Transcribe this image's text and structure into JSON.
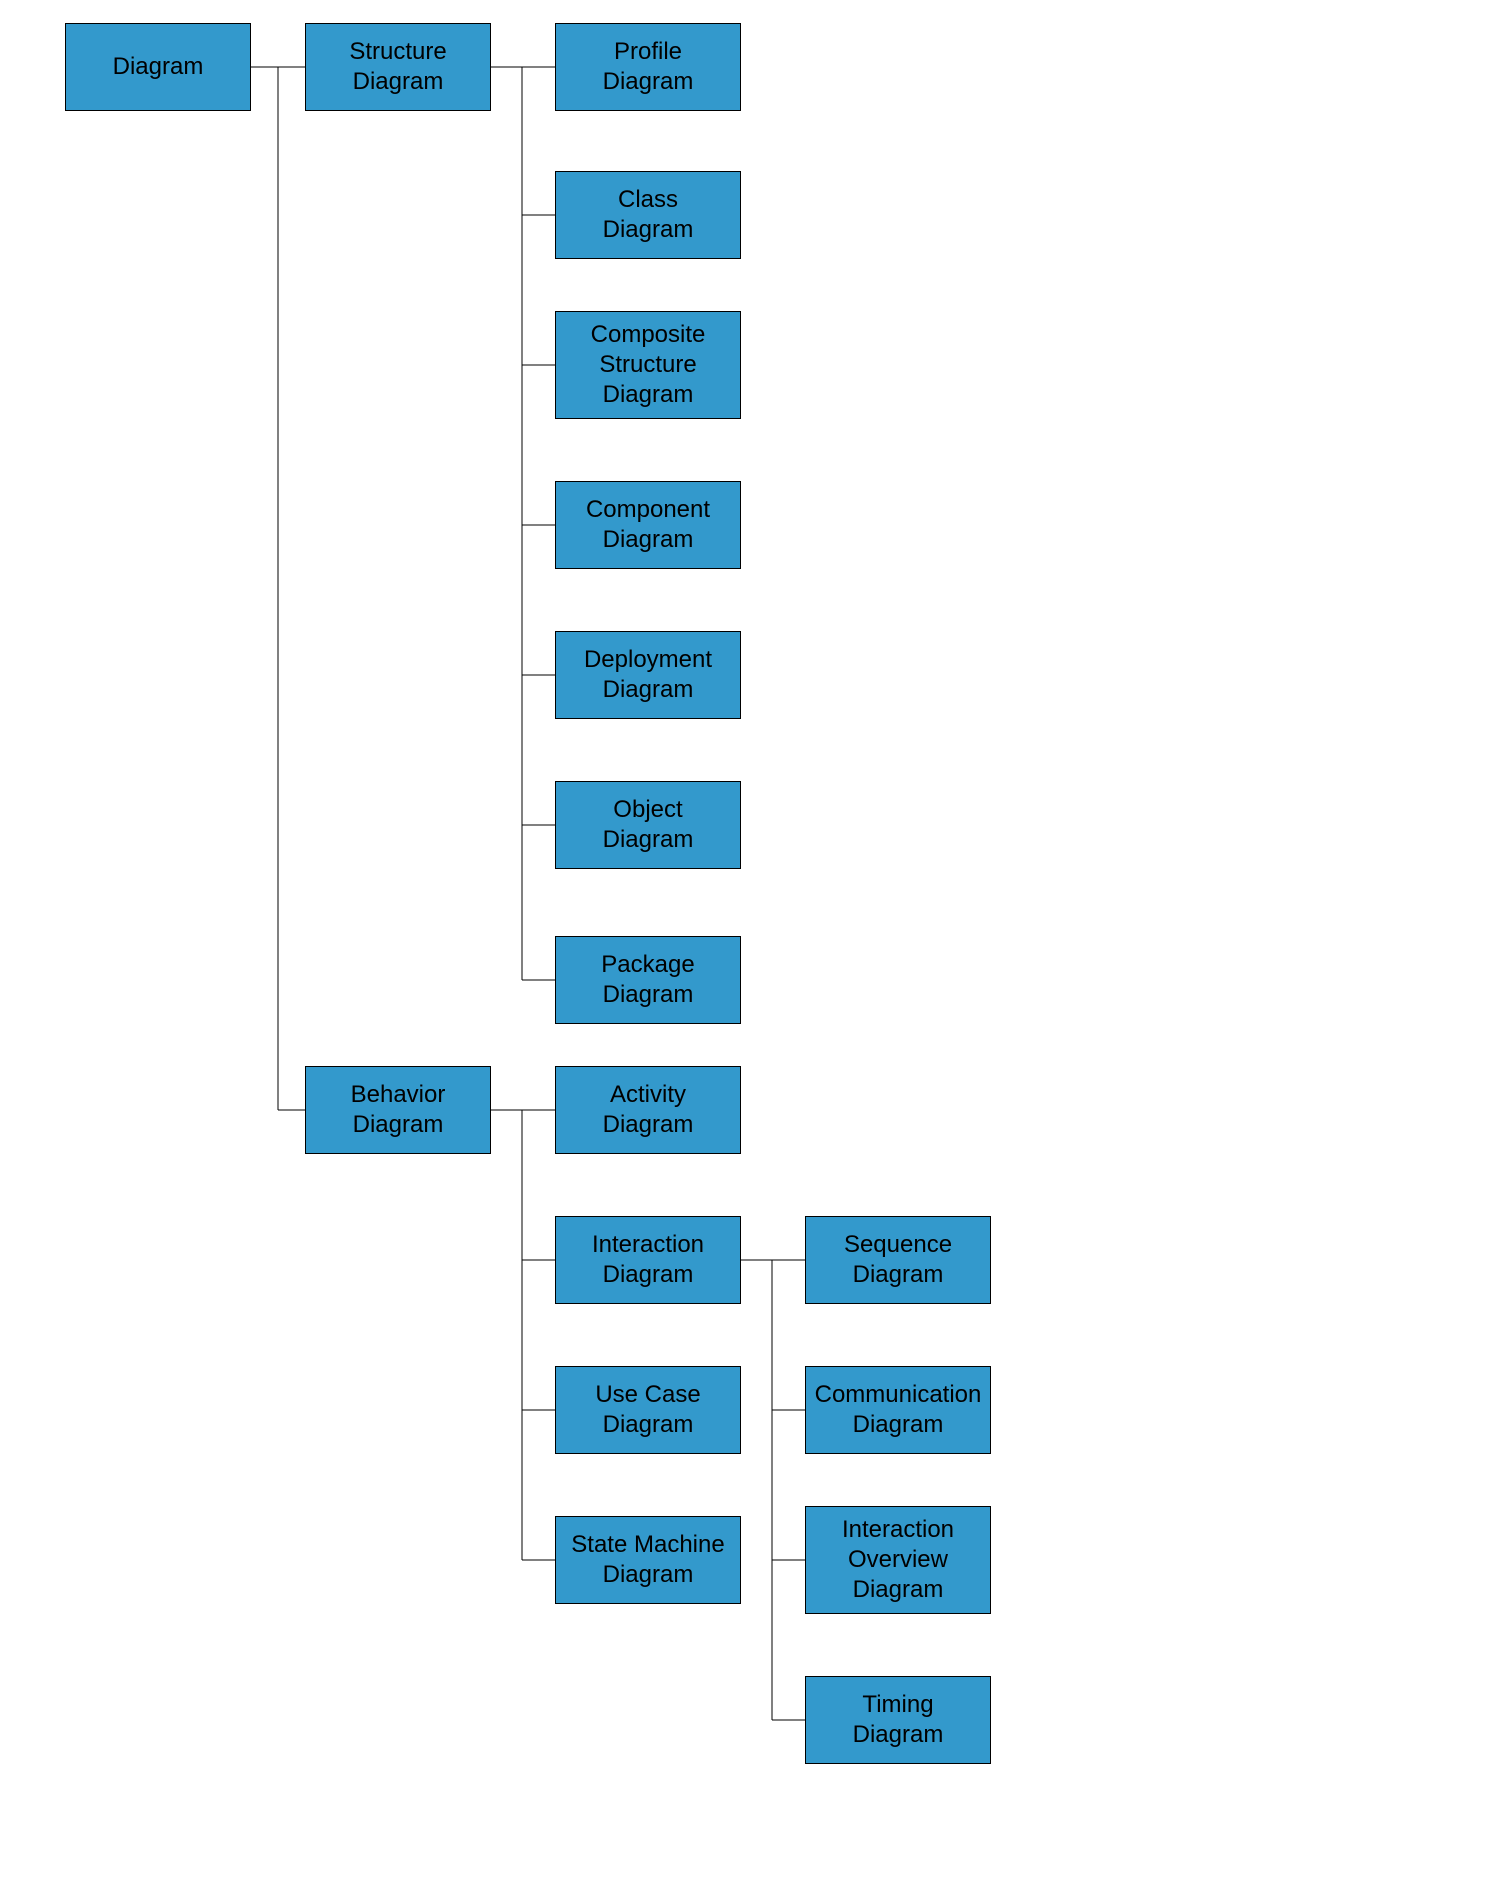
{
  "colors": {
    "box_fill": "#3399cc",
    "box_border": "#000000",
    "connector": "#000000",
    "background": "#ffffff"
  },
  "root": {
    "label_line1": "Diagram"
  },
  "structure": {
    "label_line1": "Structure",
    "label_line2": "Diagram"
  },
  "structure_children": {
    "profile": {
      "label_line1": "Profile",
      "label_line2": "Diagram"
    },
    "class": {
      "label_line1": "Class",
      "label_line2": "Diagram"
    },
    "composite": {
      "label_line1": "Composite",
      "label_line2": "Structure",
      "label_line3": "Diagram"
    },
    "component": {
      "label_line1": "Component",
      "label_line2": "Diagram"
    },
    "deployment": {
      "label_line1": "Deployment",
      "label_line2": "Diagram"
    },
    "object": {
      "label_line1": "Object",
      "label_line2": "Diagram"
    },
    "package": {
      "label_line1": "Package",
      "label_line2": "Diagram"
    }
  },
  "behavior": {
    "label_line1": "Behavior",
    "label_line2": "Diagram"
  },
  "behavior_children": {
    "activity": {
      "label_line1": "Activity",
      "label_line2": "Diagram"
    },
    "interaction": {
      "label_line1": "Interaction",
      "label_line2": "Diagram"
    },
    "usecase": {
      "label_line1": "Use Case",
      "label_line2": "Diagram"
    },
    "statemachine": {
      "label_line1": "State Machine",
      "label_line2": "Diagram"
    }
  },
  "interaction_children": {
    "sequence": {
      "label_line1": "Sequence",
      "label_line2": "Diagram"
    },
    "communication": {
      "label_line1": "Communication",
      "label_line2": "Diagram"
    },
    "overview": {
      "label_line1": "Interaction",
      "label_line2": "Overview",
      "label_line3": "Diagram"
    },
    "timing": {
      "label_line1": "Timing",
      "label_line2": "Diagram"
    }
  }
}
